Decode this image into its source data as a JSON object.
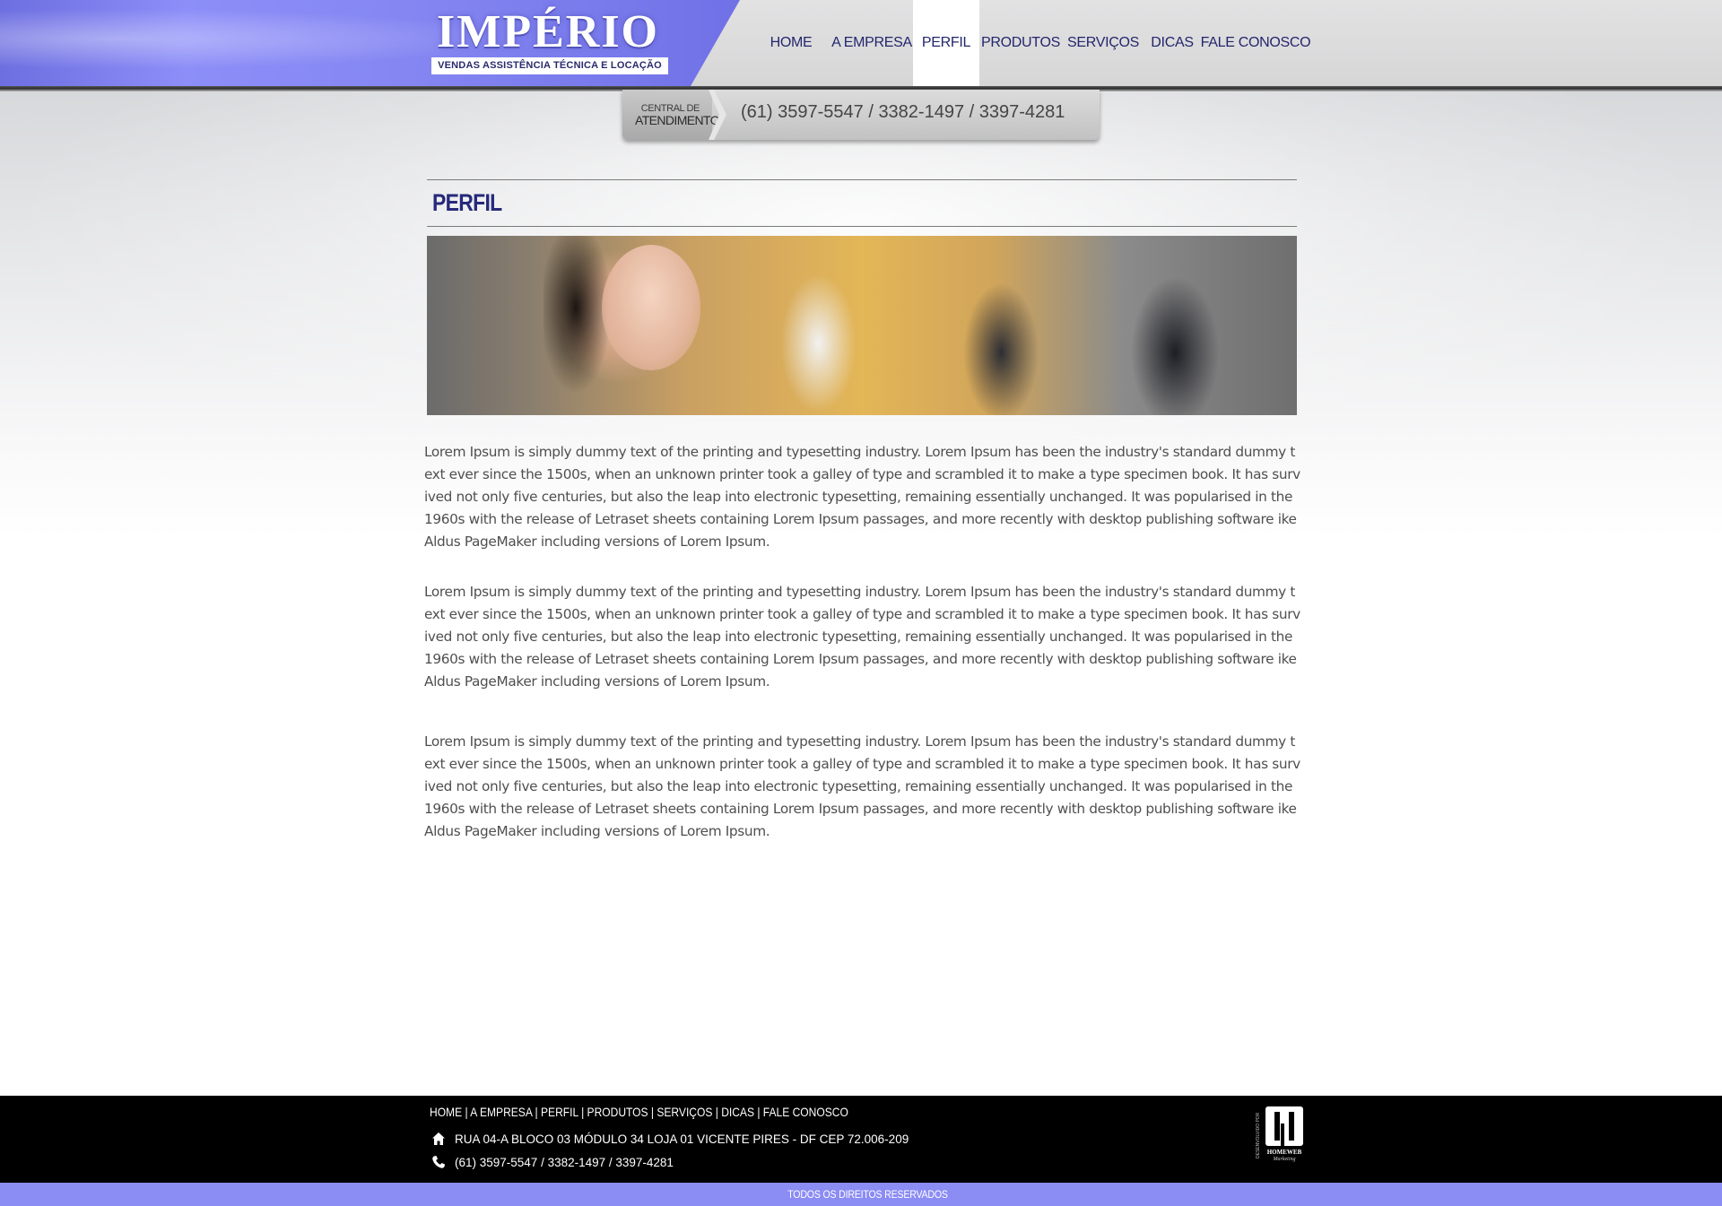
{
  "logo": {
    "title": "IMPÉRIO",
    "tagline": "VENDAS ASSISTÊNCIA TÉCNICA E LOCAÇÃO"
  },
  "nav": {
    "items": [
      {
        "label": "HOME"
      },
      {
        "label": "A EMPRESA"
      },
      {
        "label": "PERFIL",
        "active": true
      },
      {
        "label": "PRODUTOS"
      },
      {
        "label": "SERVIÇOS"
      },
      {
        "label": "DICAS"
      },
      {
        "label": "FALE CONOSCO"
      }
    ]
  },
  "central": {
    "label_line1": "CENTRAL DE",
    "label_line2": "ATENDIMENTO",
    "phone": "(61) 3597-5547 / 3382-1497 / 3397-4281"
  },
  "content": {
    "page_title": "PERFIL",
    "paragraphs": [
      "Lorem Ipsum is simply dummy text of the printing and typesetting industry. Lorem Ipsum has been the industry's standard dummy text ever since the 1500s, when an unknown printer took a galley of type and scrambled it to make a type specimen book. It has survived not only five centuries, but also the leap into electronic typesetting, remaining essentially unchanged. It was popularised in the 1960s with the release of Letraset sheets containing Lorem Ipsum passages, and more recently with desktop publishing software ike Aldus PageMaker including versions of Lorem Ipsum.",
      "Lorem Ipsum is simply dummy text of the printing and typesetting industry. Lorem Ipsum has been the industry's standard dummy text ever since the 1500s, when an unknown printer took a galley of type and scrambled it to make a type specimen book. It has survived not only five centuries, but also the leap into electronic typesetting, remaining essentially unchanged. It was popularised in the 1960s with the release of Letraset sheets containing Lorem Ipsum passages, and more recently with desktop publishing software ike Aldus PageMaker including versions of Lorem Ipsum.",
      "Lorem Ipsum is simply dummy text of the printing and typesetting industry. Lorem Ipsum has been the industry's standard dummy text ever since the 1500s, when an unknown printer took a galley of type and scrambled it to make a type specimen book. It has survived not only five centuries, but also the leap into electronic typesetting, remaining essentially unchanged. It was popularised in the 1960s with the release of Letraset sheets containing Lorem Ipsum passages, and more recently with desktop publishing software ike Aldus PageMaker including versions of Lorem Ipsum."
    ]
  },
  "footer": {
    "nav_text": "HOME | A EMPRESA | PERFIL | PRODUTOS | SERVIÇOS | DICAS | FALE CONOSCO",
    "address": "RUA 04-A BLOCO 03 MÓDULO 34 LOJA 01 VICENTE PIRES - DF CEP 72.006-209",
    "phone": "(61) 3597-5547 / 3382-1497 / 3397-4281",
    "address_icon": "home-icon",
    "phone_icon": "phone-icon",
    "credit_side": "DESENVOLVIDO POR",
    "credit_name": "HOMEWEB",
    "credit_sub": "Marketing",
    "copyright": "TODOS OS DIREITOS RESERVADOS"
  },
  "colors": {
    "brand_purple": "#8b8cf4",
    "nav_text": "#23266b",
    "footer_bg": "#000000"
  }
}
